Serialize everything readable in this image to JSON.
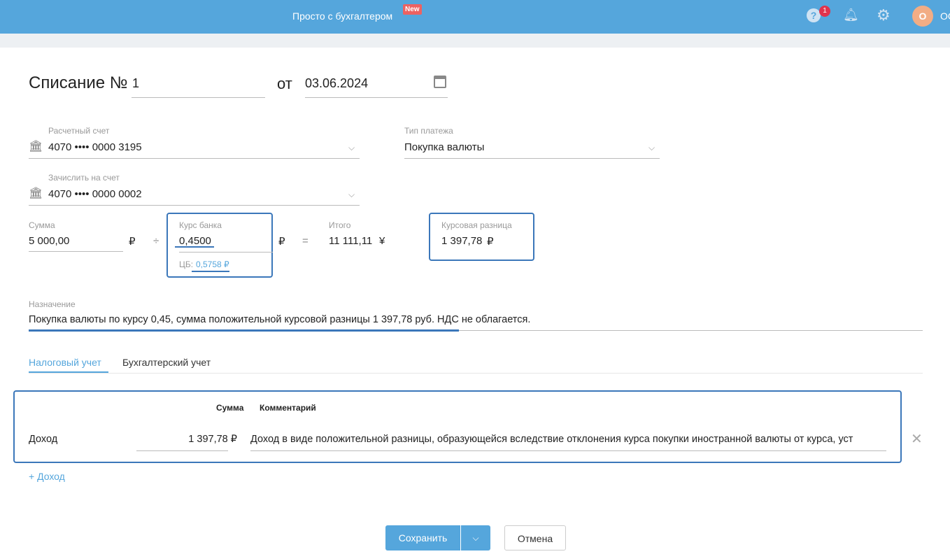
{
  "header": {
    "brand": "Просто с бухгалтером",
    "new_badge": "New",
    "help_count": "1",
    "avatar_letter": "О",
    "user": "ОС"
  },
  "form": {
    "title": "Списание №",
    "number": "1",
    "from": "от",
    "date": "03.06.2024",
    "account": {
      "label": "Расчетный счет",
      "value": "4070 •••• 0000 3195"
    },
    "payment_type": {
      "label": "Тип платежа",
      "value": "Покупка валюты"
    },
    "to_account": {
      "label": "Зачислить на счет",
      "value": "4070 •••• 0000 0002"
    },
    "sum": {
      "label": "Сумма",
      "value": "5 000,00",
      "currency": "₽"
    },
    "divide": "÷",
    "rate": {
      "label": "Курс банка",
      "value": "0,4500",
      "currency": "₽",
      "cb_label": "ЦБ:",
      "cb_value": "0,5758 ₽"
    },
    "equals": "=",
    "total": {
      "label": "Итого",
      "value": "11 111,11",
      "currency": "¥"
    },
    "diff": {
      "label": "Курсовая разница",
      "value": "1 397,78",
      "currency": "₽"
    },
    "purpose": {
      "label": "Назначение",
      "value": "Покупка валюты по курсу 0,45, сумма положительной курсовой разницы 1 397,78 руб. НДС не облагается."
    }
  },
  "tabs": [
    {
      "label": "Налоговый учет",
      "active": true
    },
    {
      "label": "Бухгалтерский учет",
      "active": false
    }
  ],
  "table": {
    "headers": {
      "sum": "Сумма",
      "comment": "Комментарий"
    },
    "rows": [
      {
        "type": "Доход",
        "sum": "1 397,78 ₽",
        "comment": "Доход в виде положительной разницы, образующейся вследствие отклонения курса покупки иностранной валюты от курса, уст"
      }
    ],
    "add": "+ Доход"
  },
  "buttons": {
    "save": "Сохранить",
    "cancel": "Отмена"
  },
  "colors": {
    "accent": "#55a6dc",
    "highlight": "#3b77ba"
  }
}
